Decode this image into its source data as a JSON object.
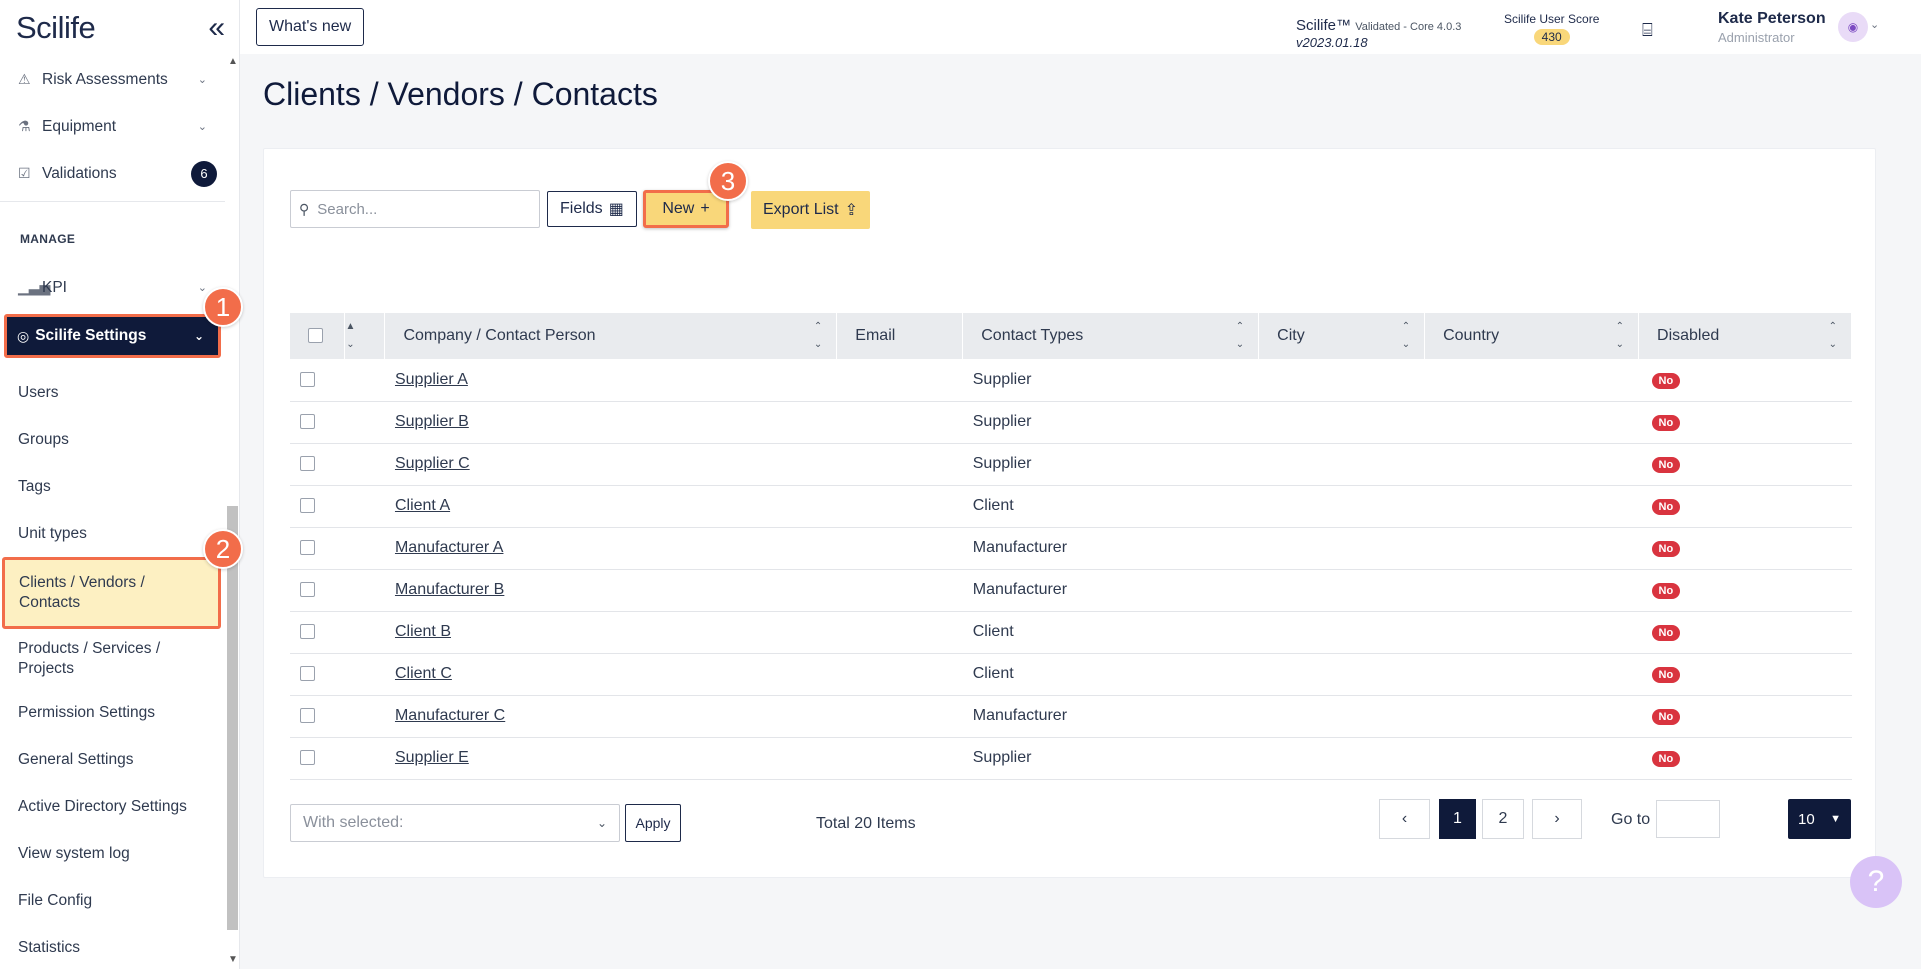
{
  "app": {
    "logo": "Scilife",
    "collapse_icon": "chevrons-left-icon"
  },
  "sidebar": {
    "items_top": [
      {
        "label": "Risk Assessments",
        "icon": "warning-icon"
      },
      {
        "label": "Equipment",
        "icon": "flask-icon"
      },
      {
        "label": "Validations",
        "icon": "clipboard-icon",
        "badge": "6"
      }
    ],
    "section_manage": "MANAGE",
    "kpi_label": "KPI",
    "settings_label": "Scilife Settings",
    "sub_items": [
      {
        "label": "Users"
      },
      {
        "label": "Groups"
      },
      {
        "label": "Tags"
      },
      {
        "label": "Unit types"
      },
      {
        "label": "Clients / Vendors / Contacts",
        "active": true
      },
      {
        "label": "Products / Services / Projects"
      },
      {
        "label": "Permission Settings"
      },
      {
        "label": "General Settings"
      },
      {
        "label": "Active Directory Settings"
      },
      {
        "label": "View system log"
      },
      {
        "label": "File Config"
      },
      {
        "label": "Statistics"
      }
    ]
  },
  "steps": [
    "1",
    "2",
    "3"
  ],
  "header": {
    "whats_new": "What's new",
    "product": "Scilife™",
    "validated": "Validated - Core 4.0.3",
    "version": "v2023.01.18",
    "score_label": "Scilife User Score",
    "score_value": "430",
    "user_name": "Kate Peterson",
    "user_role": "Administrator"
  },
  "page": {
    "title": "Clients / Vendors / Contacts"
  },
  "toolbar": {
    "search_placeholder": "Search...",
    "fields_label": "Fields",
    "new_label": "New",
    "export_label": "Export List"
  },
  "table": {
    "columns": [
      "Company / Contact Person",
      "Email",
      "Contact Types",
      "City",
      "Country",
      "Disabled"
    ],
    "rows": [
      {
        "name": "Supplier A",
        "email": "",
        "type": "Supplier",
        "city": "",
        "country": "",
        "disabled": "No"
      },
      {
        "name": "Supplier B",
        "email": "",
        "type": "Supplier",
        "city": "",
        "country": "",
        "disabled": "No"
      },
      {
        "name": "Supplier C",
        "email": "",
        "type": "Supplier",
        "city": "",
        "country": "",
        "disabled": "No"
      },
      {
        "name": "Client A",
        "email": "",
        "type": "Client",
        "city": "",
        "country": "",
        "disabled": "No"
      },
      {
        "name": "Manufacturer A",
        "email": "",
        "type": "Manufacturer",
        "city": "",
        "country": "",
        "disabled": "No"
      },
      {
        "name": "Manufacturer B",
        "email": "",
        "type": "Manufacturer",
        "city": "",
        "country": "",
        "disabled": "No"
      },
      {
        "name": "Client B",
        "email": "",
        "type": "Client",
        "city": "",
        "country": "",
        "disabled": "No"
      },
      {
        "name": "Client C",
        "email": "",
        "type": "Client",
        "city": "",
        "country": "",
        "disabled": "No"
      },
      {
        "name": "Manufacturer C",
        "email": "",
        "type": "Manufacturer",
        "city": "",
        "country": "",
        "disabled": "No"
      },
      {
        "name": "Supplier E",
        "email": "",
        "type": "Supplier",
        "city": "",
        "country": "",
        "disabled": "No"
      }
    ]
  },
  "footer": {
    "with_selected_placeholder": "With selected:",
    "apply_label": "Apply",
    "total": "Total 20 Items",
    "pages": [
      "1",
      "2"
    ],
    "current_page": "1",
    "goto_label": "Go to",
    "page_size": "10"
  },
  "colors": {
    "navy": "#0f1a3a",
    "accent_yellow": "#f9d77a",
    "highlight_orange": "#f26d4a",
    "status_red": "#d9343f"
  }
}
